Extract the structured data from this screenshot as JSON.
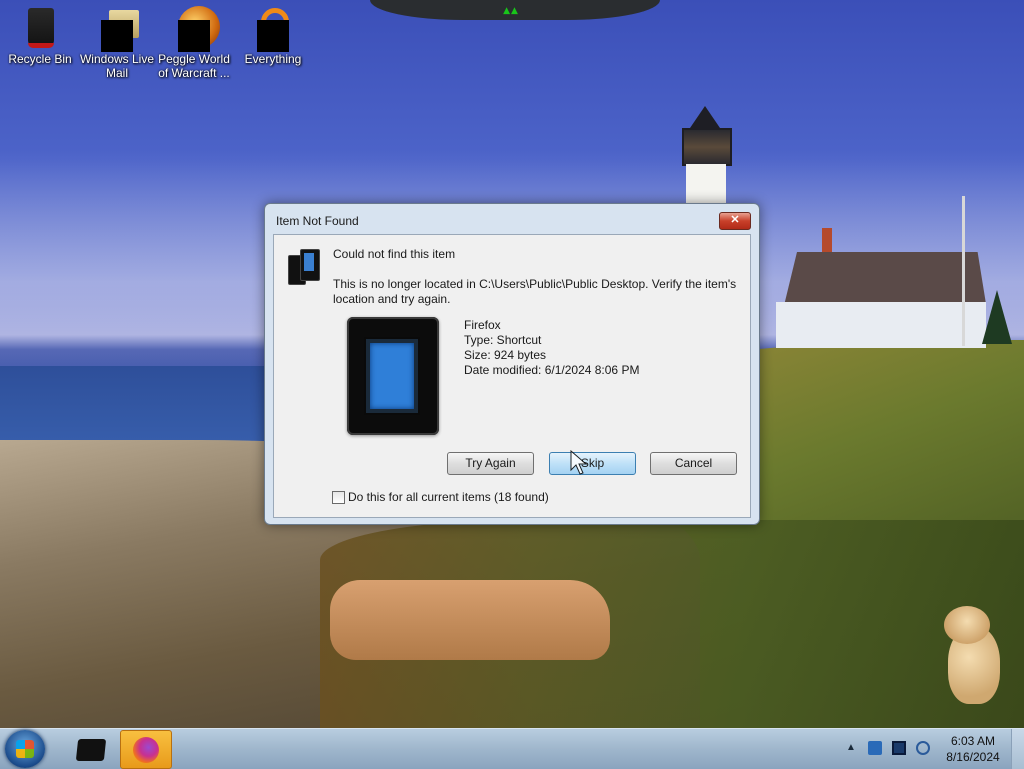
{
  "desktop": {
    "icons": [
      {
        "label": "Recycle Bin",
        "icon": "recycle-bin-icon"
      },
      {
        "label": "Windows Live Mail",
        "icon": "windows-live-mail-icon"
      },
      {
        "label": "Peggle World of Warcraft ...",
        "icon": "peggle-icon"
      },
      {
        "label": "Everything",
        "icon": "everything-icon"
      }
    ]
  },
  "dialog": {
    "title": "Item Not Found",
    "close_label": "✕",
    "headline": "Could not find this item",
    "message": "This is no longer located in C:\\Users\\Public\\Public Desktop. Verify the item's location and try again.",
    "file": {
      "name": "Firefox",
      "type": "Type: Shortcut",
      "size": "Size: 924 bytes",
      "modified": "Date modified: 6/1/2024 8:06 PM"
    },
    "buttons": {
      "try_again": "Try Again",
      "skip": "Skip",
      "cancel": "Cancel"
    },
    "checkbox": {
      "label": "Do this for all current items (18 found)",
      "checked": false
    }
  },
  "taskbar": {
    "pinned": [
      {
        "name": "Windows Explorer",
        "icon": "explorer-icon"
      },
      {
        "name": "Firefox",
        "icon": "firefox-icon",
        "active": true
      }
    ],
    "tray": {
      "show_hidden": "▲",
      "time": "6:03 AM",
      "date": "8/16/2024"
    }
  },
  "colors": {
    "dialog_bg": "#f0f0f0",
    "title_frame": "#d7e3f0",
    "close_red": "#c8402a",
    "taskbar": "#9fb6cc",
    "firefox_active": "#e89a1a"
  }
}
